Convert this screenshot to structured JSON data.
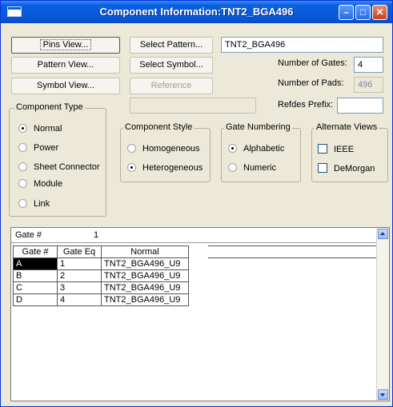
{
  "window": {
    "title": "Component Information:TNT2_BGA496"
  },
  "buttons": {
    "pins_view": "Pins View...",
    "pattern_view": "Pattern View...",
    "symbol_view": "Symbol View...",
    "select_pattern": "Select Pattern...",
    "select_symbol": "Select Symbol...",
    "reference": "Reference"
  },
  "fields": {
    "component_name": "TNT2_BGA496",
    "number_of_gates_label": "Number of Gates:",
    "number_of_gates": "4",
    "number_of_pads_label": "Number of Pads:",
    "number_of_pads": "496",
    "refdes_prefix_label": "Refdes Prefix:",
    "refdes_prefix": ""
  },
  "component_type": {
    "title": "Component Type",
    "options": [
      "Normal",
      "Power",
      "Sheet Connector",
      "Module",
      "Link"
    ],
    "selected": "Normal"
  },
  "component_style": {
    "title": "Component Style",
    "options": [
      "Homogeneous",
      "Heterogeneous"
    ],
    "selected": "Heterogeneous"
  },
  "gate_numbering": {
    "title": "Gate Numbering",
    "options": [
      "Alphabetic",
      "Numeric"
    ],
    "selected": "Alphabetic"
  },
  "alternate_views": {
    "title": "Alternate Views",
    "options": [
      "IEEE",
      "DeMorgan"
    ]
  },
  "grid": {
    "header_label": "Gate #",
    "header_value": "1",
    "columns": [
      "Gate #",
      "Gate Eq",
      "Normal"
    ],
    "rows": [
      [
        "A",
        "1",
        "TNT2_BGA496_U9"
      ],
      [
        "B",
        "2",
        "TNT2_BGA496_U9"
      ],
      [
        "C",
        "3",
        "TNT2_BGA496_U9"
      ],
      [
        "D",
        "4",
        "TNT2_BGA496_U9"
      ]
    ]
  },
  "colors": {
    "titlebar": "#0858d8",
    "dialog_bg": "#ece9d8",
    "selected_cell": "#000000"
  }
}
